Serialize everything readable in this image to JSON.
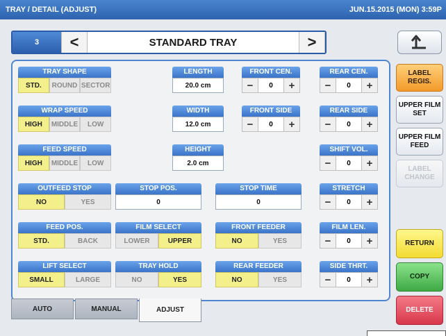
{
  "header": {
    "title": "TRAY / DETAIL (ADJUST)",
    "datetime": "JUN.15.2015 (MON)  3:59P"
  },
  "nav": {
    "number": "3",
    "prev_icon": "chevron-left",
    "next_icon": "chevron-right",
    "title": "STANDARD TRAY",
    "prev": "<",
    "next": ">"
  },
  "back_icon": "return-arrow-icon",
  "tray_shape": {
    "label": "TRAY SHAPE",
    "options": [
      "STD.",
      "ROUND",
      "SECTOR"
    ],
    "selected": 0
  },
  "wrap_speed": {
    "label": "WRAP SPEED",
    "options": [
      "HIGH",
      "MIDDLE",
      "LOW"
    ],
    "selected": 0
  },
  "feed_speed": {
    "label": "FEED SPEED",
    "options": [
      "HIGH",
      "MIDDLE",
      "LOW"
    ],
    "selected": 0
  },
  "length": {
    "label": "LENGTH",
    "value": "20.0 cm"
  },
  "width": {
    "label": "WIDTH",
    "value": "12.0 cm"
  },
  "height": {
    "label": "HEIGHT",
    "value": "2.0 cm"
  },
  "front_cen": {
    "label": "FRONT CEN.",
    "value": "0"
  },
  "front_side": {
    "label": "FRONT SIDE",
    "value": "0"
  },
  "rear_cen": {
    "label": "REAR CEN.",
    "value": "0"
  },
  "rear_side": {
    "label": "REAR SIDE",
    "value": "0"
  },
  "shift_vol": {
    "label": "SHIFT VOL.",
    "value": "0"
  },
  "stretch": {
    "label": "STRETCH",
    "value": "0"
  },
  "film_len": {
    "label": "FILM LEN.",
    "value": "0"
  },
  "side_thrt": {
    "label": "SIDE THRT.",
    "value": "0"
  },
  "outfeed_stop": {
    "label": "OUTFEED STOP",
    "options": [
      "NO",
      "YES"
    ],
    "selected": 0
  },
  "stop_pos": {
    "label": "STOP POS.",
    "value": "0"
  },
  "stop_time": {
    "label": "STOP TIME",
    "value": "0"
  },
  "feed_pos": {
    "label": "FEED POS.",
    "options": [
      "STD.",
      "BACK"
    ],
    "selected": 0
  },
  "film_select": {
    "label": "FILM SELECT",
    "options": [
      "LOWER",
      "UPPER"
    ],
    "selected": 1
  },
  "front_feeder": {
    "label": "FRONT FEEDER",
    "options": [
      "NO",
      "YES"
    ],
    "selected": 0
  },
  "lift_select": {
    "label": "LIFT SELECT",
    "options": [
      "SMALL",
      "LARGE"
    ],
    "selected": 0
  },
  "tray_hold": {
    "label": "TRAY HOLD",
    "options": [
      "NO",
      "YES"
    ],
    "selected": 1
  },
  "rear_feeder": {
    "label": "REAR FEEDER",
    "options": [
      "NO",
      "YES"
    ],
    "selected": 0
  },
  "stepper": {
    "minus": "−",
    "plus": "+"
  },
  "tabs": [
    "AUTO",
    "MANUAL",
    "ADJUST"
  ],
  "active_tab": 2,
  "side_buttons": {
    "label_regis": "LABEL\nREGIS.",
    "upper_film_set": "UPPER FILM\nSET",
    "upper_film_feed": "UPPER FILM\nFEED",
    "label_change": "LABEL\nCHANGE",
    "return": "RETURN",
    "copy": "COPY",
    "delete": "DELETE"
  },
  "colors": {
    "selected": "#f3f08c",
    "header_blue": "#3b74c8",
    "orange": "#f39a2a",
    "yellow": "#f3db32",
    "green": "#3ea944",
    "red": "#d8384b"
  }
}
